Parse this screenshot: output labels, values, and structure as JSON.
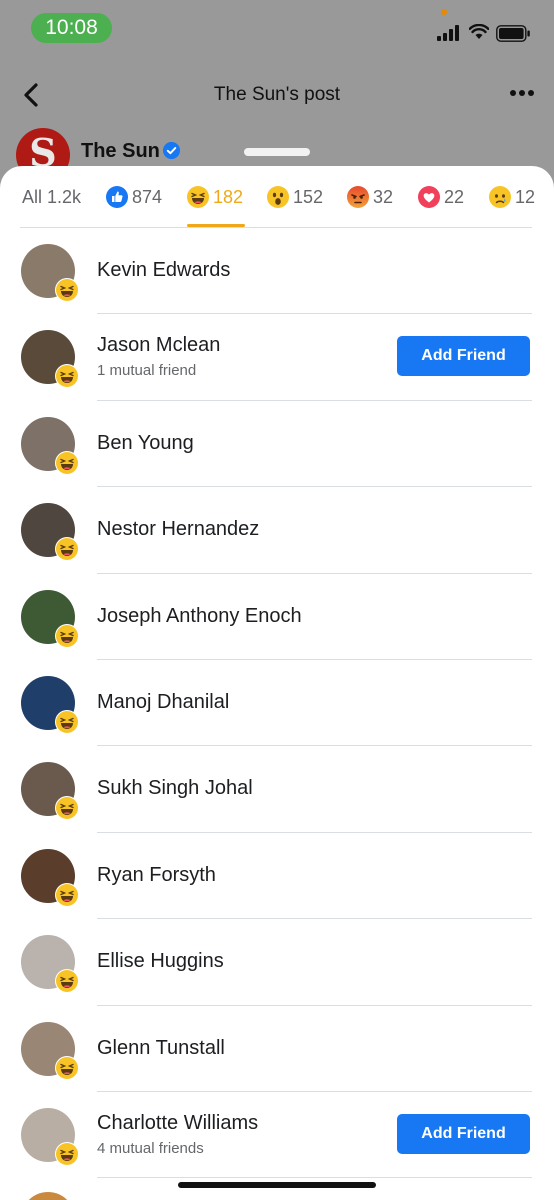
{
  "status_bar": {
    "time": "10:08"
  },
  "header": {
    "title": "The Sun's post",
    "page_name": "The Sun",
    "page_logo_letter": "S"
  },
  "tabs": [
    {
      "label": "All 1.2k",
      "icon": "none"
    },
    {
      "label": "874",
      "icon": "like-icon"
    },
    {
      "label": "182",
      "icon": "haha-icon",
      "active": true
    },
    {
      "label": "152",
      "icon": "wow-icon"
    },
    {
      "label": "32",
      "icon": "angry-icon"
    },
    {
      "label": "22",
      "icon": "love-icon"
    },
    {
      "label": "12",
      "icon": "sad-icon"
    }
  ],
  "people": [
    {
      "name": "Kevin Edwards",
      "mutual": "",
      "action": "",
      "avatar_color": "#8a7a6a"
    },
    {
      "name": "Jason Mclean",
      "mutual": "1 mutual friend",
      "action": "Add Friend",
      "avatar_color": "#5a4a3a"
    },
    {
      "name": "Ben Young",
      "mutual": "",
      "action": "",
      "avatar_color": "#7d7168"
    },
    {
      "name": "Nestor Hernandez",
      "mutual": "",
      "action": "",
      "avatar_color": "#4e463f"
    },
    {
      "name": "Joseph Anthony Enoch",
      "mutual": "",
      "action": "",
      "avatar_color": "#3e5a34"
    },
    {
      "name": "Manoj Dhanilal",
      "mutual": "",
      "action": "",
      "avatar_color": "#1f3f6a"
    },
    {
      "name": "Sukh Singh Johal",
      "mutual": "",
      "action": "",
      "avatar_color": "#6a5a4e"
    },
    {
      "name": "Ryan Forsyth",
      "mutual": "",
      "action": "",
      "avatar_color": "#5a3d2a"
    },
    {
      "name": "Ellise Huggins",
      "mutual": "",
      "action": "",
      "avatar_color": "#b9b2ad"
    },
    {
      "name": "Glenn Tunstall",
      "mutual": "",
      "action": "",
      "avatar_color": "#9a8674"
    },
    {
      "name": "Charlotte Williams",
      "mutual": "4 mutual friends",
      "action": "Add Friend",
      "avatar_color": "#b8aea4"
    }
  ],
  "colors": {
    "accent": "#f0a818",
    "button": "#1877f2",
    "status_pill": "#4caf50"
  }
}
